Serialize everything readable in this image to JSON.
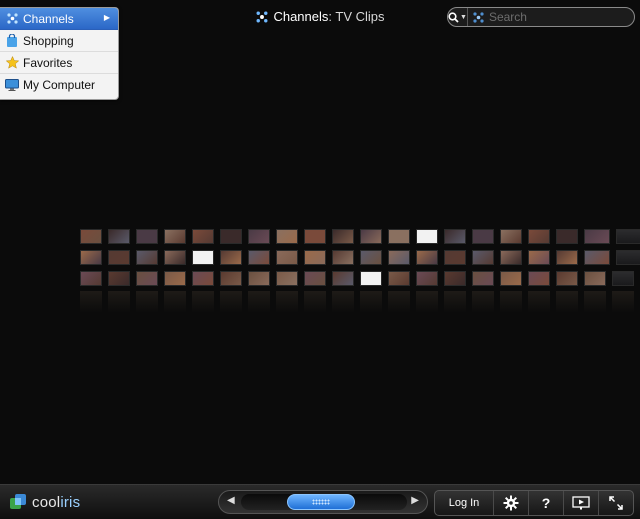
{
  "menu": {
    "items": [
      {
        "label": "Channels",
        "icon": "channels-icon",
        "active": true
      },
      {
        "label": "Shopping",
        "icon": "shopping-bag-icon",
        "active": false
      },
      {
        "label": "Favorites",
        "icon": "star-icon",
        "active": false
      },
      {
        "label": "My Computer",
        "icon": "computer-icon",
        "active": false
      }
    ]
  },
  "header": {
    "title": "Channels",
    "separator": ":",
    "subtitle": "TV Clips"
  },
  "search": {
    "placeholder": "Search"
  },
  "bottom_bar": {
    "brand_part1": "cool",
    "brand_part2": "iris",
    "login_label": "Log In",
    "help_label": "?"
  },
  "colors": {
    "accent": "#2b67c7",
    "background": "#0b0b0b",
    "scroll_thumb": "#3a8ae8"
  }
}
